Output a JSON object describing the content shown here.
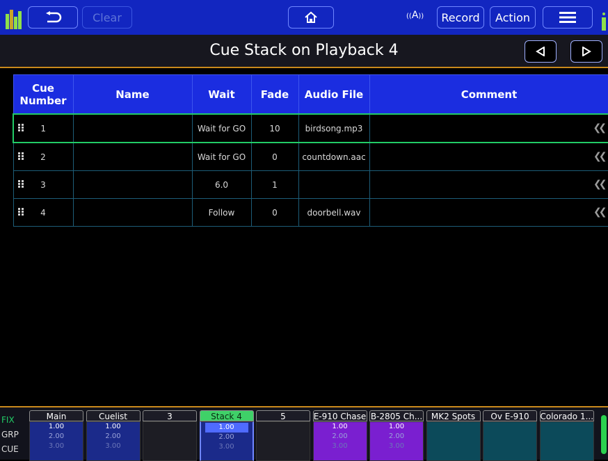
{
  "topbar": {
    "back_icon": "undo-arrow-icon",
    "clear_label": "Clear",
    "home_icon": "home-icon",
    "wireless_icon": "wireless-a-icon",
    "wireless_text": "A",
    "record_label": "Record",
    "action_label": "Action",
    "menu_icon": "hamburger-menu-icon"
  },
  "titlebar": {
    "title": "Cue Stack on Playback 4",
    "prev_icon": "triangle-left-icon",
    "next_icon": "triangle-right-icon"
  },
  "table": {
    "headers": {
      "cue_number": "Cue Number",
      "name": "Name",
      "wait": "Wait",
      "fade": "Fade",
      "audio_file": "Audio File",
      "comment": "Comment"
    },
    "rows": [
      {
        "number": "1",
        "name": "",
        "wait": "Wait for GO",
        "fade": "10",
        "audio": "birdsong.mp3",
        "comment": ""
      },
      {
        "number": "2",
        "name": "",
        "wait": "Wait for GO",
        "fade": "0",
        "audio": "countdown.aac",
        "comment": ""
      },
      {
        "number": "3",
        "name": "",
        "wait": "6.0",
        "fade": "1",
        "audio": "",
        "comment": ""
      },
      {
        "number": "4",
        "name": "",
        "wait": "Follow",
        "fade": "0",
        "audio": "doorbell.wav",
        "comment": ""
      }
    ],
    "selected_row": 0
  },
  "bottom": {
    "side_labels": {
      "fix": "FIX",
      "grp": "GRP",
      "cue": "CUE"
    },
    "playbacks": [
      {
        "label": "Main",
        "v1": "1.00",
        "v2": "2.00",
        "v3": "3.00",
        "color": "#1b2a8a"
      },
      {
        "label": "Cuelist",
        "v1": "1.00",
        "v2": "2.00",
        "v3": "3.00",
        "color": "#1b2a8a"
      },
      {
        "label": "3",
        "v1": "",
        "v2": "",
        "v3": "",
        "color": "#1d1d24"
      },
      {
        "label": "Stack 4",
        "v1": "1.00",
        "v2": "2.00",
        "v3": "3.00",
        "color": "#1b2a8a",
        "active": true
      },
      {
        "label": "5",
        "v1": "",
        "v2": "",
        "v3": "",
        "color": "#1d1d24"
      },
      {
        "label": "E-910 Chase",
        "v1": "1.00",
        "v2": "2.00",
        "v3": "3.00",
        "color": "#7a1fd0"
      },
      {
        "label": "B-2805 Ch...",
        "v1": "1.00",
        "v2": "2.00",
        "v3": "3.00",
        "color": "#7a1fd0"
      },
      {
        "label": "MK2 Spots",
        "v1": "",
        "v2": "",
        "v3": "",
        "color": "#0c4a5a"
      },
      {
        "label": "Ov E-910",
        "v1": "",
        "v2": "",
        "v3": "",
        "color": "#0c4a5a"
      },
      {
        "label": "Colorado 1...",
        "v1": "",
        "v2": "",
        "v3": "",
        "color": "#0c4a5a"
      }
    ]
  },
  "colors": {
    "accent_blue": "#1226c0",
    "header_blue": "#1b2de0",
    "selected_green": "#22cc66",
    "divider_orange": "#c9891c",
    "fader_green": "#2bd14f"
  }
}
